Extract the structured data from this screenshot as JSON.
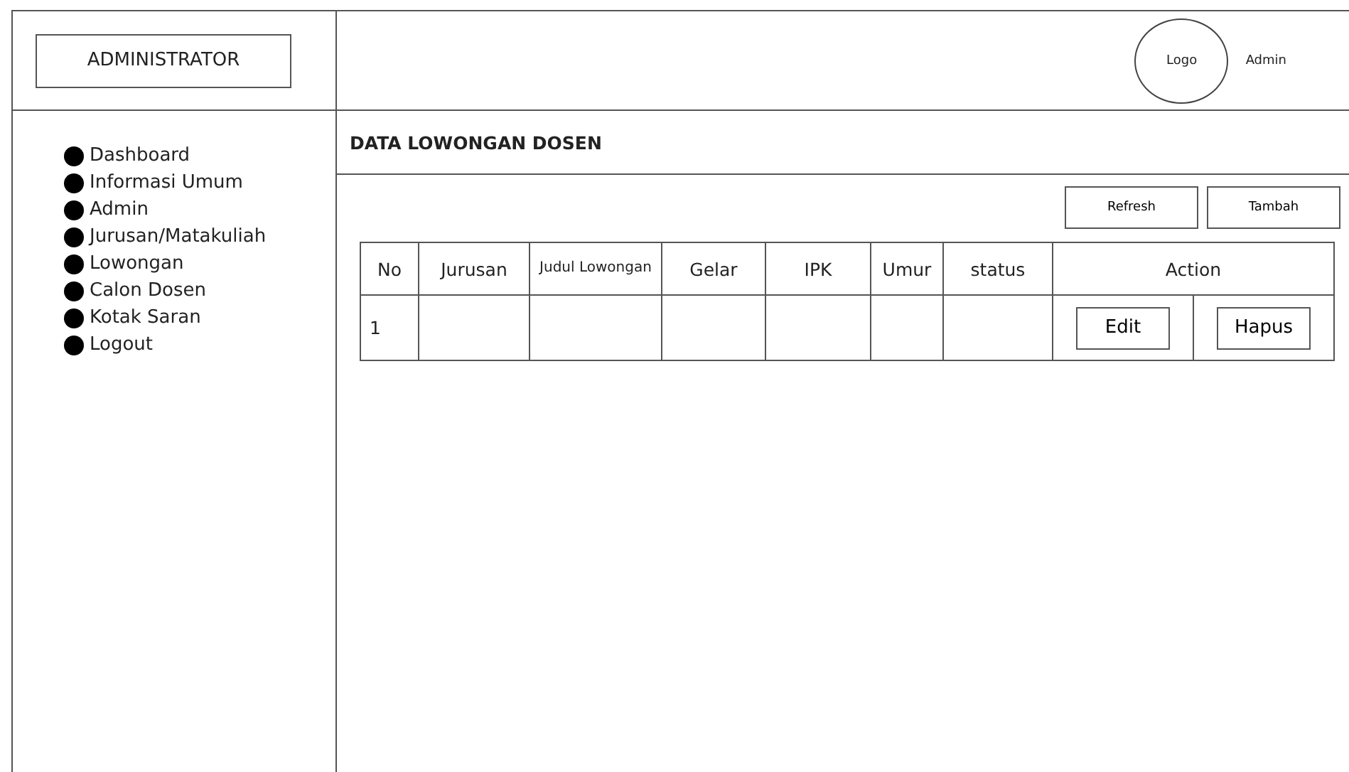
{
  "brand": "ADMINISTRATOR",
  "header": {
    "logo": "Logo",
    "user": "Admin"
  },
  "sidebar": {
    "items": [
      "Dashboard",
      "Informasi Umum",
      "Admin",
      "Jurusan/Matakuliah",
      "Lowongan",
      "Calon Dosen",
      "Kotak Saran",
      "Logout"
    ]
  },
  "page_title": "DATA LOWONGAN DOSEN",
  "toolbar": [
    "Refresh",
    "Tambah"
  ],
  "table": {
    "columns": [
      "No",
      "Jurusan",
      "Judul Lowongan",
      "Gelar",
      "IPK",
      "Umur",
      "status",
      "Action"
    ],
    "rows": [
      {
        "no": "1",
        "actions": [
          "Edit",
          "Hapus"
        ]
      }
    ]
  }
}
